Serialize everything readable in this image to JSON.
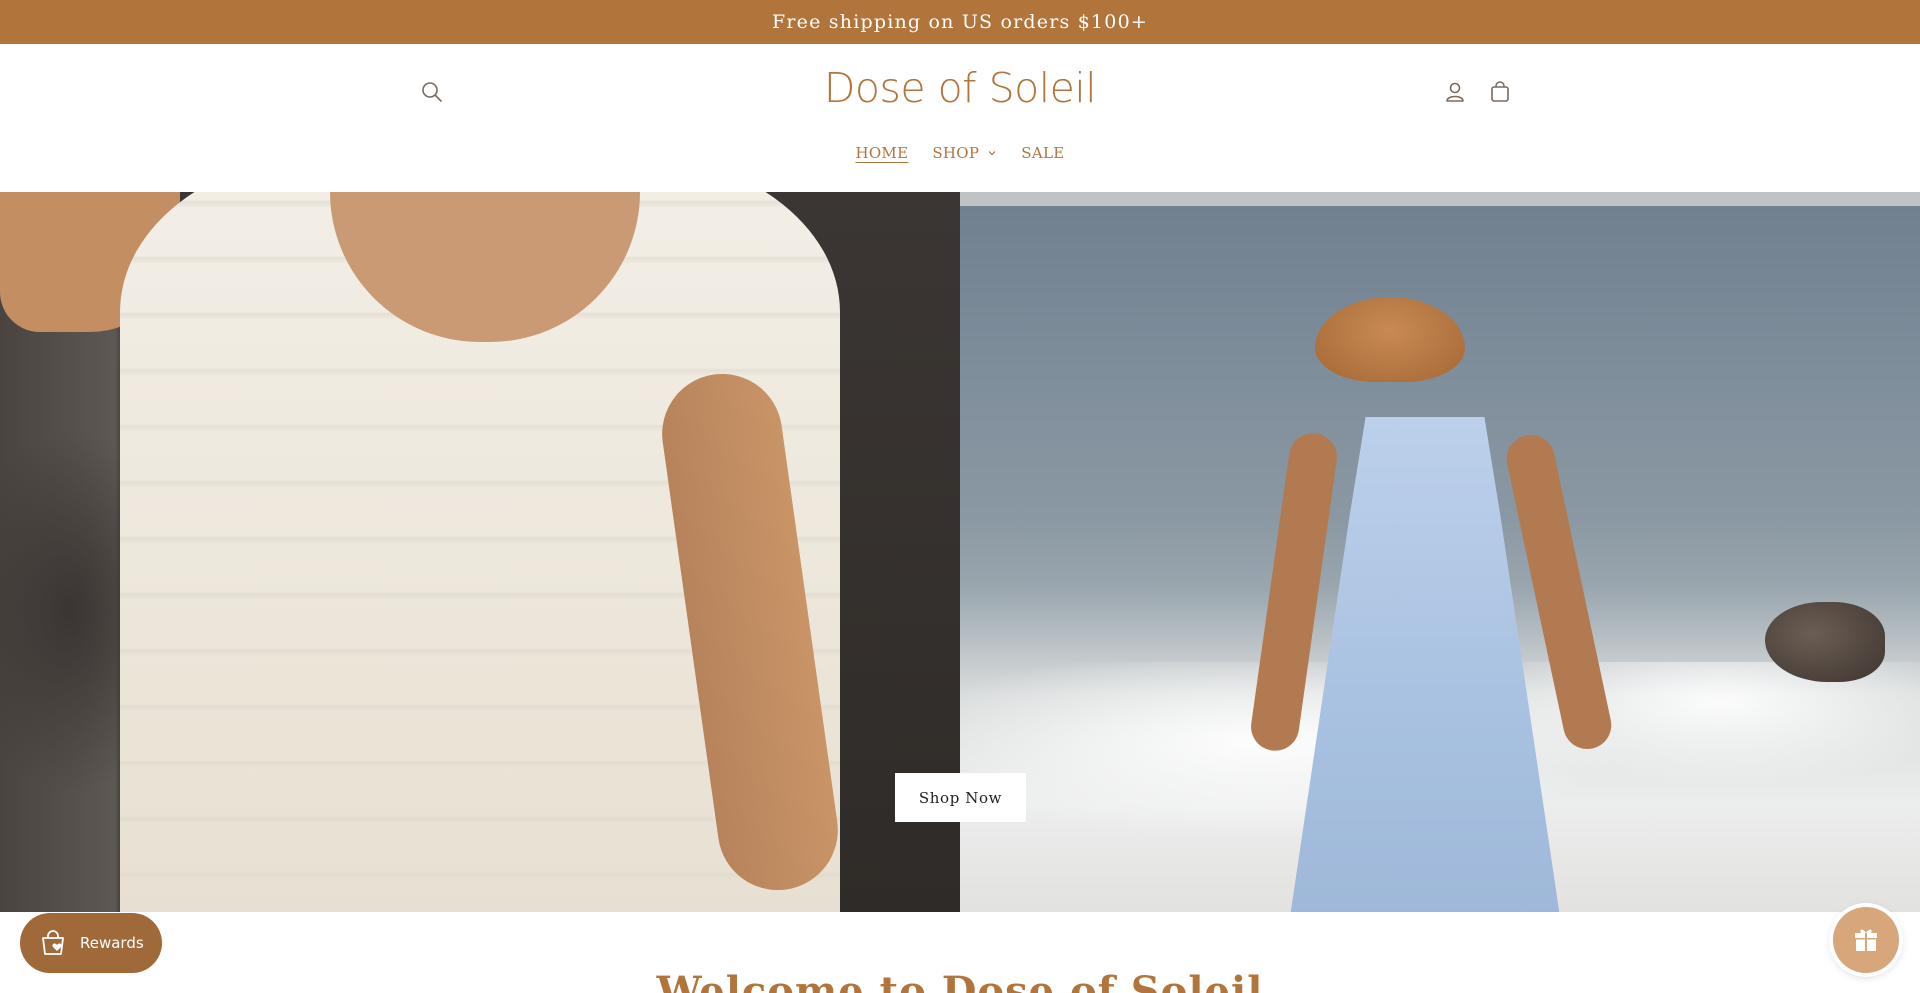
{
  "announcement": {
    "text": "Free shipping on US orders $100+"
  },
  "header": {
    "logo": "Dose of Soleil",
    "icons": {
      "search": "search-icon",
      "account": "account-icon",
      "cart": "cart-icon"
    }
  },
  "nav": {
    "items": [
      {
        "label": "HOME",
        "active": true
      },
      {
        "label": "SHOP",
        "has_dropdown": true
      },
      {
        "label": "SALE"
      }
    ]
  },
  "hero": {
    "cta_label": "Shop Now"
  },
  "welcome": {
    "title": "Welcome to Dose of Soleil"
  },
  "widgets": {
    "rewards_label": "Rewards",
    "gift_icon": "gift-icon"
  },
  "colors": {
    "brand": "#b1753c",
    "announcement_bg": "#b1753b",
    "rewards_bg": "#a0693a"
  }
}
